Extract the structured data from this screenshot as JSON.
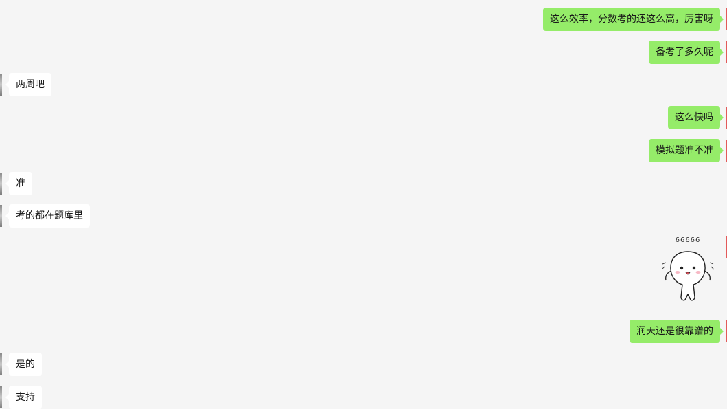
{
  "messages": [
    {
      "side": "out",
      "text": "这么效率，分数考的还这么高，厉害呀"
    },
    {
      "side": "out",
      "text": "备考了多久呢"
    },
    {
      "side": "in",
      "text": "两周吧"
    },
    {
      "side": "out",
      "text": "这么快吗"
    },
    {
      "side": "out",
      "text": "模拟题准不准"
    },
    {
      "side": "in",
      "text": "准"
    },
    {
      "side": "in",
      "text": "考的都在题库里"
    },
    {
      "side": "out",
      "sticker": "cute-blob-sticker",
      "caption": "66666"
    },
    {
      "side": "out",
      "text": "润天还是很靠谱的"
    },
    {
      "side": "in",
      "text": "是的"
    },
    {
      "side": "in",
      "text": "支持"
    }
  ],
  "colors": {
    "outgoing_bubble": "#95ec69",
    "incoming_bubble": "#ffffff",
    "background": "#f5f5f5"
  }
}
